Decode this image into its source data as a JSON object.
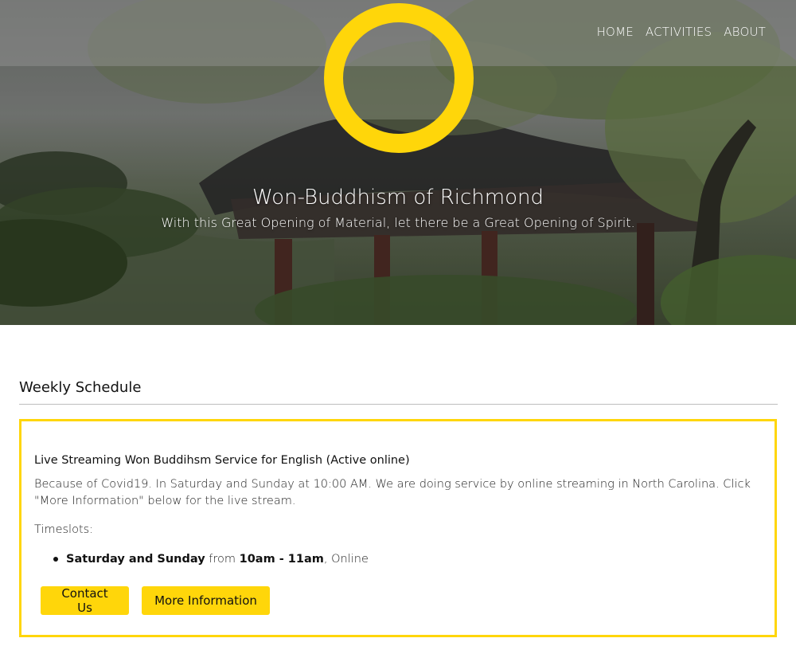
{
  "nav": {
    "items": [
      {
        "label": "HOME"
      },
      {
        "label": "ACTIVITIES"
      },
      {
        "label": "ABOUT"
      }
    ]
  },
  "hero": {
    "title": "Won-Buddhism of Richmond",
    "subtitle": "With this Great Opening of Material, let there be a Great Opening of Spirit."
  },
  "schedule": {
    "heading": "Weekly Schedule",
    "card": {
      "title": "Live Streaming Won Buddihsm Service for English (Active online)",
      "description": "Because of Covid19. In Saturday and Sunday at 10:00 AM. We are doing service by online streaming in North Carolina. Click \"More Information\" below for the live stream.",
      "timeslots_label": "Timeslots:",
      "slot": {
        "days": "Saturday and Sunday",
        "from": "from",
        "time": "10am - 11am",
        "sep": ",",
        "location": "Online"
      },
      "buttons": {
        "contact": "Contact Us",
        "more": "More Information"
      }
    }
  },
  "colors": {
    "accent": "#ffd60a",
    "logo_ring": "#ffd60a"
  },
  "icons": {
    "logo": "won-circle-logo",
    "bullet": "bullet-dot-icon"
  }
}
